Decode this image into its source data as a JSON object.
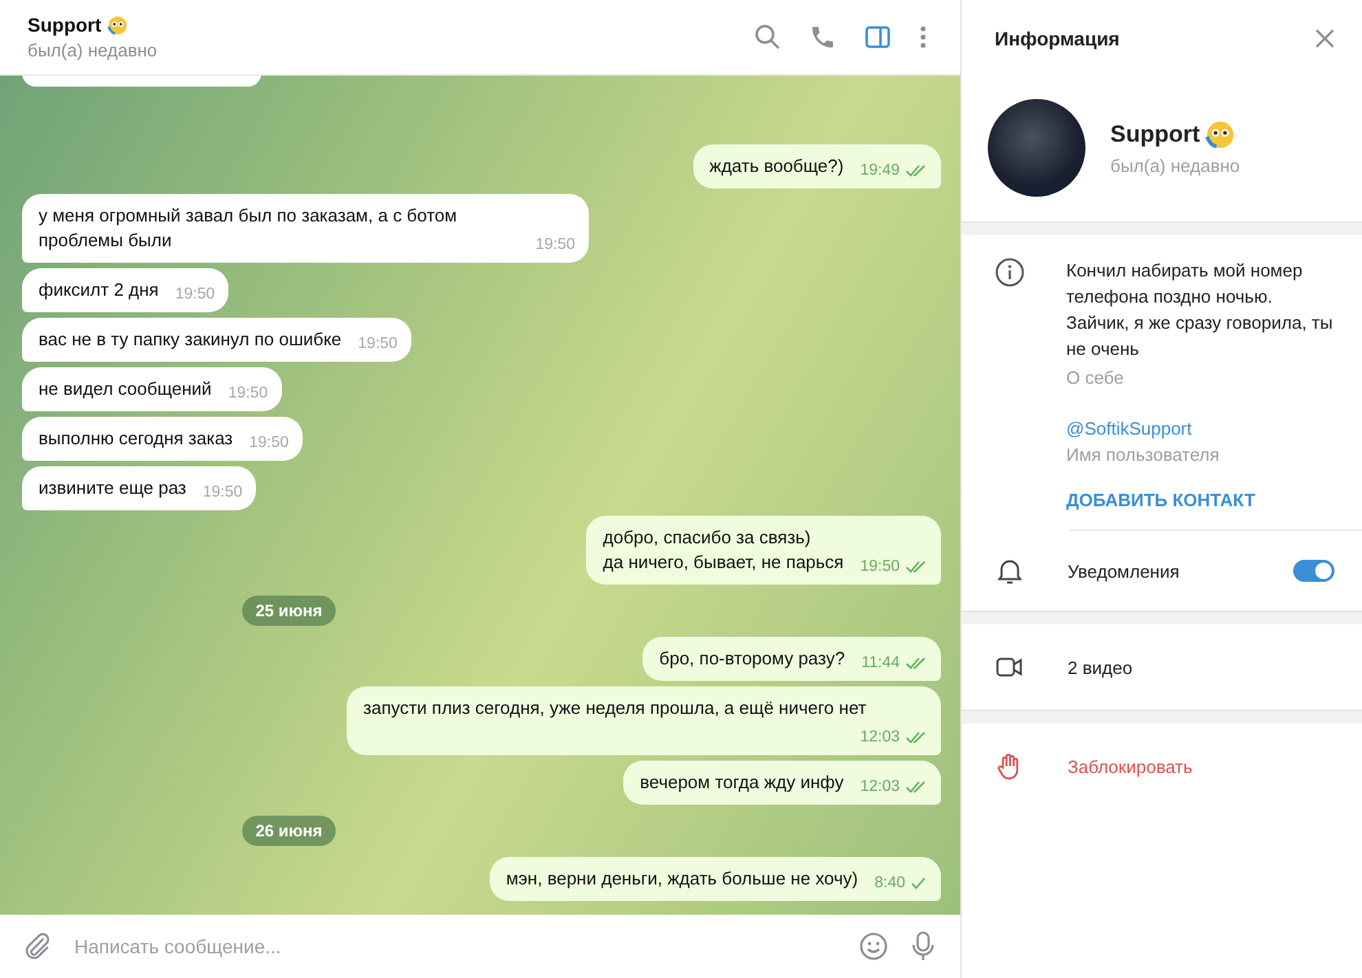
{
  "chat_header": {
    "name": "Support",
    "status": "был(а) недавно"
  },
  "messages": [
    {
      "kind": "stub",
      "outgoing": false
    },
    {
      "kind": "message",
      "outgoing": true,
      "text": "ждать вообще?)",
      "time": "19:49",
      "read": true
    },
    {
      "kind": "message",
      "outgoing": false,
      "text": "у меня огромный завал был по заказам, а с ботом проблемы были",
      "time": "19:50"
    },
    {
      "kind": "message",
      "outgoing": false,
      "text": "фиксилт 2 дня",
      "time": "19:50"
    },
    {
      "kind": "message",
      "outgoing": false,
      "text": "вас не в ту папку закинул по ошибке",
      "time": "19:50"
    },
    {
      "kind": "message",
      "outgoing": false,
      "text": "не видел сообщений",
      "time": "19:50"
    },
    {
      "kind": "message",
      "outgoing": false,
      "text": "выполню сегодня заказ",
      "time": "19:50"
    },
    {
      "kind": "message",
      "outgoing": false,
      "text": "извините еще раз",
      "time": "19:50"
    },
    {
      "kind": "message",
      "outgoing": true,
      "text": "добро, спасибо за связь)\nда ничего, бывает, не парься",
      "time": "19:50",
      "read": true
    },
    {
      "kind": "date",
      "text": "25 июня"
    },
    {
      "kind": "message",
      "outgoing": true,
      "text": "бро, по-второму разу?",
      "time": "11:44",
      "read": true
    },
    {
      "kind": "message",
      "outgoing": true,
      "text": "запусти плиз сегодня, уже неделя прошла, а ещё ничего нет",
      "time": "12:03",
      "read": true
    },
    {
      "kind": "message",
      "outgoing": true,
      "text": "вечером тогда жду инфу",
      "time": "12:03",
      "read": true
    },
    {
      "kind": "date",
      "text": "26 июня"
    },
    {
      "kind": "message",
      "outgoing": true,
      "text": "мэн, верни деньги, ждать больше не хочу)",
      "time": "8:40",
      "read": false
    }
  ],
  "composer": {
    "placeholder": "Написать сообщение..."
  },
  "info_panel": {
    "title": "Информация",
    "name": "Support",
    "status": "был(а) недавно",
    "bio": "Кончил набирать мой номер телефона поздно ночью. Зайчик, я же сразу говорила, ты не очень",
    "bio_label": "О себе",
    "username": "@SoftikSupport",
    "username_label": "Имя пользователя",
    "add_contact": "ДОБАВИТЬ КОНТАКТ",
    "notifications": {
      "label": "Уведомления",
      "on": true
    },
    "media": "2 видео",
    "block": "Заблокировать"
  }
}
